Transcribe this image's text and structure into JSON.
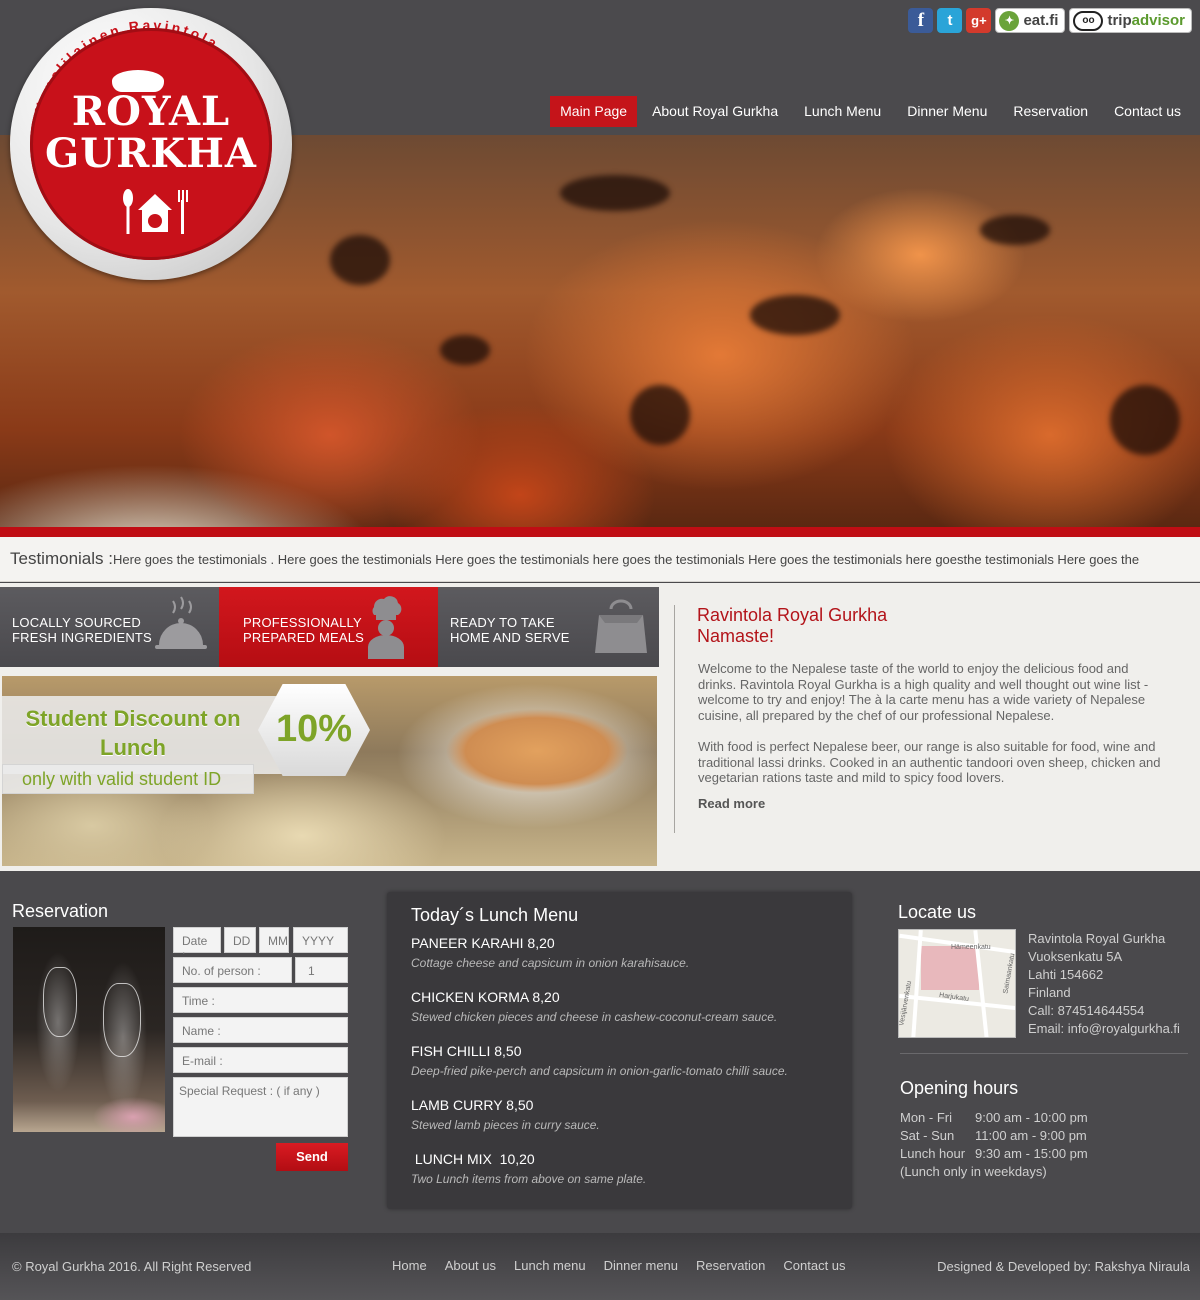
{
  "social": {
    "facebook": "f",
    "twitter": "t",
    "google": "g+",
    "eat_label": "eat.fi",
    "tripadvisor_label_a": "trip",
    "tripadvisor_label_b": "advisor"
  },
  "logo": {
    "ring_text": "Nepalilainen Ravintola",
    "line1": "ROYAL",
    "line2": "GURKHA"
  },
  "nav": {
    "items": [
      "Main Page",
      "About Royal Gurkha",
      "Lunch Menu",
      "Dinner Menu",
      "Reservation",
      "Contact us"
    ],
    "active_color": "#c5141a"
  },
  "testimonials": {
    "label": "Testimonials :",
    "text": "Here goes the testimonials . Here goes the testimonials Here goes the testimonials here goes the testimonials Here goes the testimonials here goesthe testimonials Here goes the"
  },
  "features": [
    {
      "line1": "LOCALLY SOURCED",
      "line2": "FRESH INGREDIENTS",
      "icon": "cloche-icon"
    },
    {
      "line1": "PROFESSIONALLY",
      "line2": "PREPARED MEALS",
      "icon": "chef-icon"
    },
    {
      "line1": "READY TO TAKE",
      "line2": "HOME AND SERVE",
      "icon": "takeaway-box-icon"
    }
  ],
  "promo": {
    "title_line1": "Student Discount on",
    "title_line2": "Lunch",
    "subtitle": "only with valid student ID",
    "percent": "10%",
    "accent": "#7ea428"
  },
  "intro": {
    "title_line1": "Ravintola Royal Gurkha",
    "title_line2": "Namaste!",
    "para1": "Welcome to the Nepalese taste of the world to enjoy the delicious food and drinks. Ravintola Royal Gurkha is a high quality and well thought out wine list - welcome to try and enjoy! The à la carte menu has a wide variety of Nepalese cuisine, all prepared by the chef of our professional Nepalese.",
    "para2": "With food is perfect Nepalese beer, our range is also suitable for food, wine and traditional lassi drinks. Cooked in an authentic tandoori oven sheep, chicken and vegetarian rations taste and mild to spicy food lovers.",
    "read_more": "Read more"
  },
  "reservation": {
    "title": "Reservation",
    "date_label": "Date :",
    "dd": "DD",
    "mm": "MM",
    "yyyy": "YYYY",
    "persons_label": "No. of person :",
    "persons_value": "1",
    "time_label": "Time :",
    "name_label": "Name :",
    "email_label": "E-mail :",
    "request_label": "Special Request : ( if any )",
    "send": "Send"
  },
  "lunch": {
    "title": "Today´s Lunch Menu",
    "dishes": [
      {
        "name": "PANEER KARAHI  8,20",
        "desc": "Cottage cheese and capsicum in onion karahisauce."
      },
      {
        "name": "CHICKEN KORMA  8,20",
        "desc": "Stewed chicken pieces and cheese in cashew-coconut-cream sauce."
      },
      {
        "name": "FISH CHILLI  8,50",
        "desc": "Deep-fried pike-perch and capsicum in onion-garlic-tomato chilli sauce."
      },
      {
        "name": "LAMB CURRY  8,50",
        "desc": "Stewed lamb pieces in curry sauce."
      },
      {
        "name": " LUNCH MIX  10,20",
        "desc": "Two Lunch items from above on same plate."
      }
    ]
  },
  "locate": {
    "title": "Locate us",
    "address": [
      "Ravintola Royal Gurkha",
      "Vuoksenkatu 5A",
      "Lahti 154662",
      "Finland",
      "Call: 874514644554",
      "Email: info@royalgurkha.fi"
    ],
    "map_labels": [
      "Hämeenkatu",
      "Saimaankatu",
      "Harjukatu",
      "Vesijärvenkatu"
    ]
  },
  "hours": {
    "title": "Opening hours",
    "rows": [
      {
        "day": "Mon - Fri",
        "time": "9:00 am - 10:00 pm"
      },
      {
        "day": "Sat - Sun",
        "time": "11:00 am - 9:00 pm"
      },
      {
        "day": "Lunch hour",
        "time": "9:30 am - 15:00 pm"
      }
    ],
    "note": "(Lunch only in weekdays)"
  },
  "footer": {
    "copyright": "© Royal Gurkha 2016. All Right Reserved",
    "links": [
      "Home",
      "About us",
      "Lunch menu",
      "Dinner menu",
      "Reservation",
      "Contact us"
    ],
    "credit": "Designed & Developed by: Rakshya Niraula"
  }
}
